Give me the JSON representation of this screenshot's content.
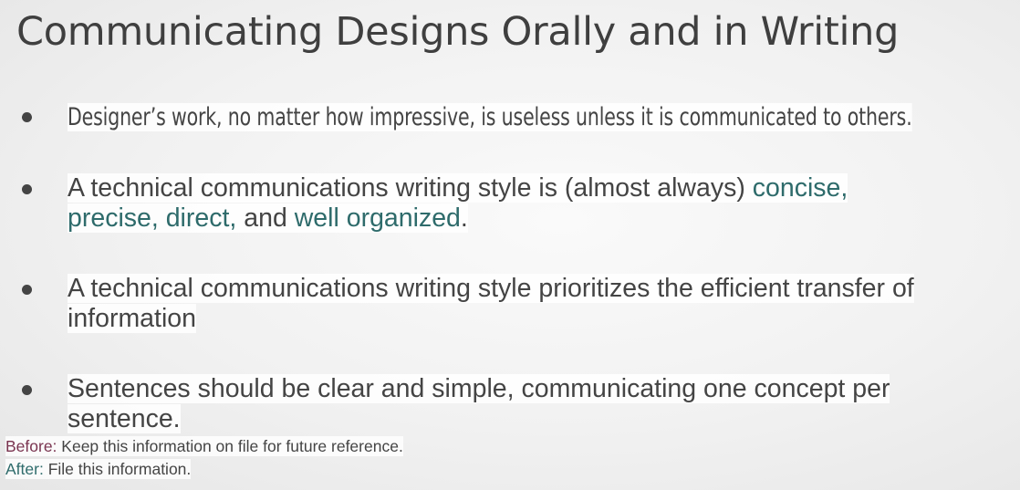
{
  "slide": {
    "title": "Communicating Designs Orally and in Writing"
  },
  "bullets": [
    {
      "text": "Designer’s work, no matter how impressive, is useless unless it is communicated to others."
    },
    {
      "line1_plain": "A technical communications writing style is (almost always) ",
      "line1_accent": "concise,",
      "line2_accent_a": "precise, direct,",
      "line2_plain": " and ",
      "line2_accent_b": "well organized",
      "line2_end": "."
    },
    {
      "line1": "A technical communications writing style prioritizes the efficient transfer of",
      "line2": "information"
    },
    {
      "line1": "Sentences should be clear and simple, communicating one concept per",
      "line2": "sentence."
    }
  ],
  "captions": {
    "before_label": "Before:",
    "before_text": " Keep this information on file for future reference.",
    "after_label": "After:",
    "after_text": " File this information."
  },
  "colors": {
    "accent": "#2e6b6b",
    "before_label": "#7a3450",
    "text": "#444444"
  }
}
